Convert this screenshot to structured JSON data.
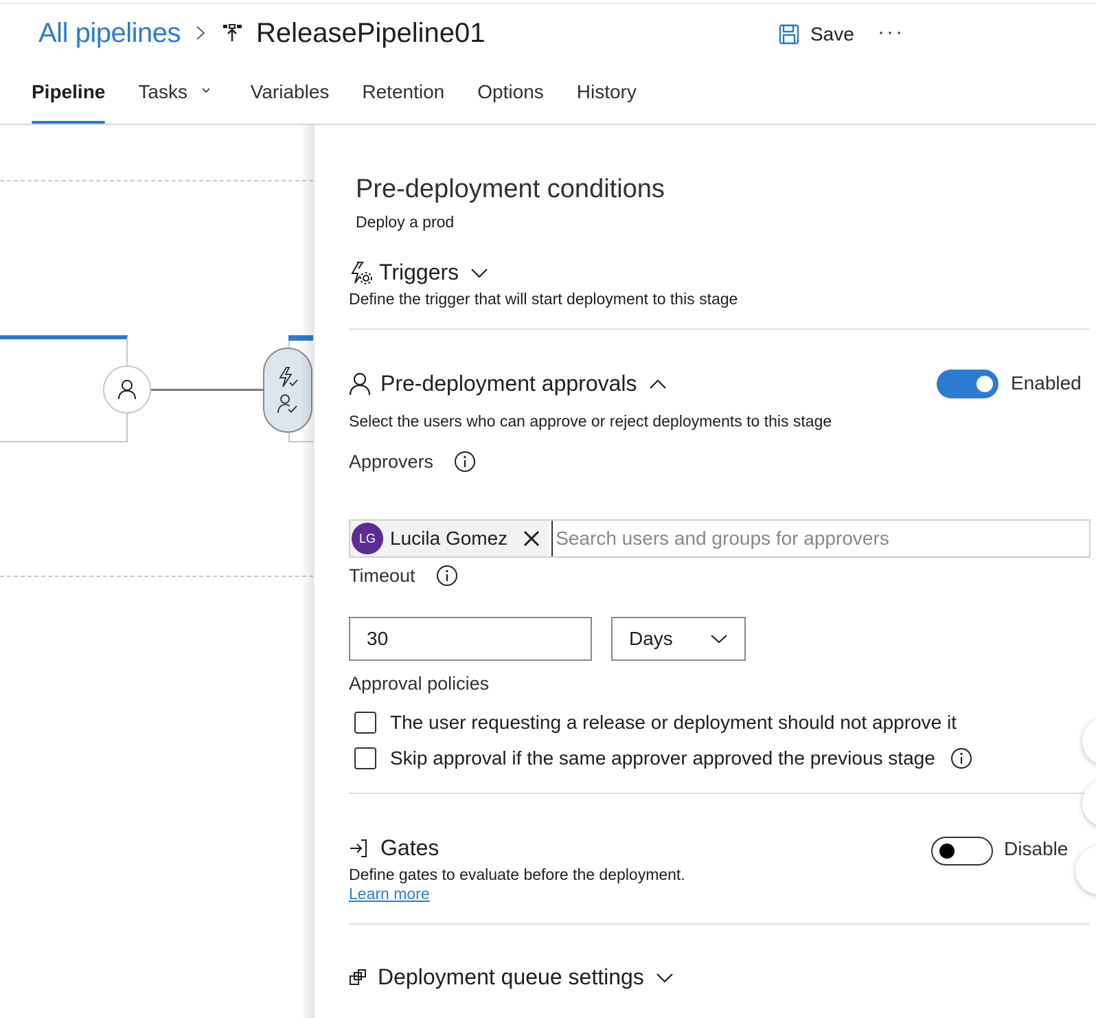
{
  "header": {
    "breadcrumb_link": "All pipelines",
    "pipeline_name": "ReleasePipeline01",
    "save_label": "Save",
    "more_label": "···"
  },
  "tabs": [
    {
      "label": "Pipeline",
      "active": true
    },
    {
      "label": "Tasks",
      "has_dropdown": true
    },
    {
      "label": "Variables"
    },
    {
      "label": "Retention"
    },
    {
      "label": "Options"
    },
    {
      "label": "History"
    }
  ],
  "panel": {
    "title": "Pre-deployment conditions",
    "subtitle": "Deploy a prod",
    "triggers": {
      "title": "Triggers",
      "description": "Define the trigger that will start deployment to this stage"
    },
    "approvals": {
      "title": "Pre-deployment approvals",
      "description": "Select the users who can approve or reject deployments to this stage",
      "toggle_label": "Enabled",
      "enabled": true,
      "approvers_label": "Approvers",
      "approver": {
        "initials": "LG",
        "name": "Lucila Gomez"
      },
      "search_placeholder": "Search users and groups for approvers",
      "timeout_label": "Timeout",
      "timeout_value": "30",
      "timeout_unit": "Days",
      "policies_label": "Approval policies",
      "policies": [
        {
          "label": "The user requesting a release or deployment should not approve it",
          "checked": false
        },
        {
          "label": "Skip approval if the same approver approved the previous stage",
          "checked": false
        }
      ]
    },
    "gates": {
      "title": "Gates",
      "description": "Define gates to evaluate before the deployment.",
      "learn_more": "Learn more",
      "toggle_label": "Disable",
      "enabled": false
    },
    "queue": {
      "title": "Deployment queue settings"
    }
  },
  "colors": {
    "accent": "#2b7bd1",
    "avatar": "#5c2d91"
  }
}
